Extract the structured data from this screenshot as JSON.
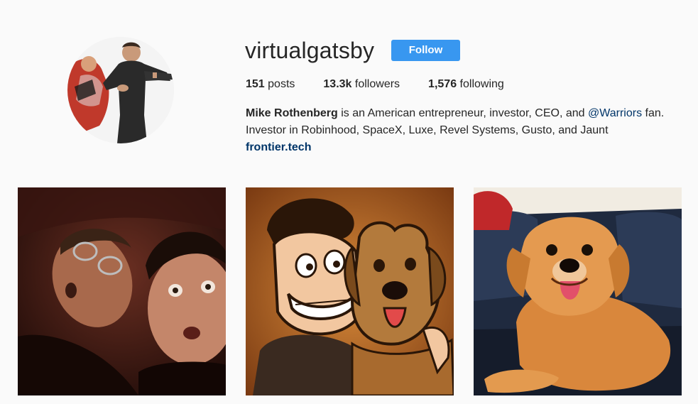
{
  "profile": {
    "username": "virtualgatsby",
    "follow_label": "Follow",
    "stats": {
      "posts_count": "151",
      "posts_label": "posts",
      "followers_count": "13.3k",
      "followers_label": "followers",
      "following_count": "1,576",
      "following_label": "following"
    },
    "bio": {
      "name": "Mike Rothenberg",
      "text_1": " is an American entrepreneur, investor, CEO, and ",
      "mention": "@Warriors",
      "text_2": " fan.",
      "line_2": "Investor in Robinhood, SpaceX, Luxe, Revel Systems, Gusto, and Jaunt",
      "website": "frontier.tech"
    }
  },
  "colors": {
    "accent": "#3897f0",
    "link": "#003569",
    "background": "#fafafa"
  },
  "posts": [
    {
      "description_icon": "selfie-photo"
    },
    {
      "description_icon": "cartoon-photo"
    },
    {
      "description_icon": "puppy-photo"
    }
  ]
}
